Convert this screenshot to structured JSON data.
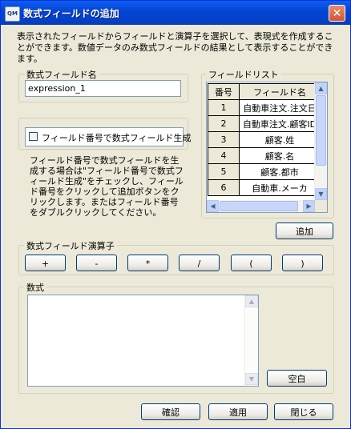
{
  "window": {
    "title": "数式フィールドの追加",
    "app_icon_text": "QM",
    "close_glyph": "✕"
  },
  "description": "表示されたフィールドからフィールドと演算子を選択して、表現式を作成することができます。数値データのみ数式フィールドの結果として表示することができます。",
  "formula_field_name": {
    "legend": "数式フィールド名",
    "value": "expression_1"
  },
  "field_number_option": {
    "label": "フィールド番号で数式フィールド生成",
    "checked": false,
    "help": "フィールド番号で数式フィールドを生成する場合は\"フィールド番号で数式フィールド生成\"をチェックし、フィールド番号をクリックして追加ボタンをクリックします。またはフィールド番号をダブルクリックしてください。"
  },
  "field_list": {
    "legend": "フィールドリスト",
    "columns": [
      "番号",
      "フィールド名"
    ],
    "rows": [
      {
        "num": "1",
        "name": "自動車注文.注文日"
      },
      {
        "num": "2",
        "name": "自動車注文.顧客ID"
      },
      {
        "num": "3",
        "name": "顧客.姓"
      },
      {
        "num": "4",
        "name": "顧客.名"
      },
      {
        "num": "5",
        "name": "顧客.都市"
      },
      {
        "num": "6",
        "name": "自動車.メーカ"
      }
    ],
    "add_button": "追加"
  },
  "operators": {
    "legend": "数式フィールド演算子",
    "items": [
      "+",
      "-",
      "*",
      "/",
      "(",
      ")"
    ]
  },
  "formula": {
    "legend": "数式",
    "value": "",
    "clear_button": "空白"
  },
  "footer": {
    "ok": "確認",
    "apply": "適用",
    "close": "閉じる"
  },
  "colors": {
    "titlebar": "#0546d6",
    "face": "#ece9d8",
    "button_border": "#003c74"
  }
}
